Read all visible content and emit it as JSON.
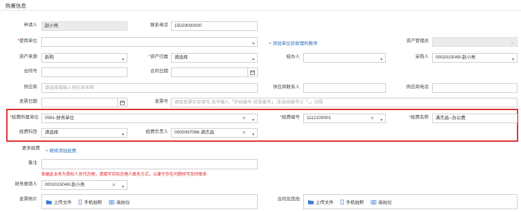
{
  "header": {
    "title": "购置信息"
  },
  "fields": {
    "applicant": {
      "label": "申请人",
      "value": "赵小亮"
    },
    "phone": {
      "label": "联系电话",
      "value": "15029000000"
    },
    "use_unit": {
      "label": "*使用单位",
      "value": ""
    },
    "add_unit_link": "添加单位验收理所教师",
    "asset_manager": {
      "label": "资产管理员",
      "value": ""
    },
    "asset_source": {
      "label": "资产来源",
      "value": "新购"
    },
    "asset_belong": {
      "label": "*资产归属",
      "value": "请选择"
    },
    "handler": {
      "label": "经办人",
      "value": ""
    },
    "buyer": {
      "label": "采购人",
      "value": "0002015049-赵小亮"
    },
    "contract_no": {
      "label": "合同号",
      "value": ""
    },
    "contract_date": {
      "label": "合同日期",
      "value": ""
    },
    "supplier": {
      "label": "供应商",
      "value": "请选择或输入供应商名称"
    },
    "supplier_contact": {
      "label": "供应商联系人",
      "value": ""
    },
    "supplier_phone": {
      "label": "供应商电话",
      "value": ""
    },
    "invoice_date": {
      "label": "发票日期",
      "value": ""
    },
    "invoice_no": {
      "label": "发票号",
      "value": "请按发票实际填写,连号输入「开始编号-结束编号」,非连续编号以「,」分隔"
    },
    "fund_unit": {
      "label": "*经费所属单位",
      "value": "0581-财务单位"
    },
    "fund_no": {
      "label": "*经费编号",
      "value": "1112100001"
    },
    "fund_name": {
      "label": "*经费名称",
      "value": "满杰昌--办公费"
    },
    "fund_subject": {
      "label": "经费科目",
      "value": "请选择"
    },
    "fund_owner": {
      "label": "经费负责人",
      "value": "0000097096-满杰昌"
    },
    "more_funds": {
      "label": "更多经费",
      "link": "继续添加经费"
    },
    "remark": {
      "label": "备注",
      "value": ""
    },
    "notice": "依据此业务为授权人员代办理，请填写实际办理人联系方式，以便于存在问题时可及时联系",
    "finance_reporter": {
      "label": "财务报销人",
      "value": "0002015049-赵小亮"
    },
    "invoice_attach": {
      "label": "发票照片"
    },
    "contract_attach": {
      "label": "合同及其他"
    },
    "upload": {
      "file": "上传文件",
      "phone_photo": "手机拍照",
      "scanner": "高拍仪"
    }
  }
}
